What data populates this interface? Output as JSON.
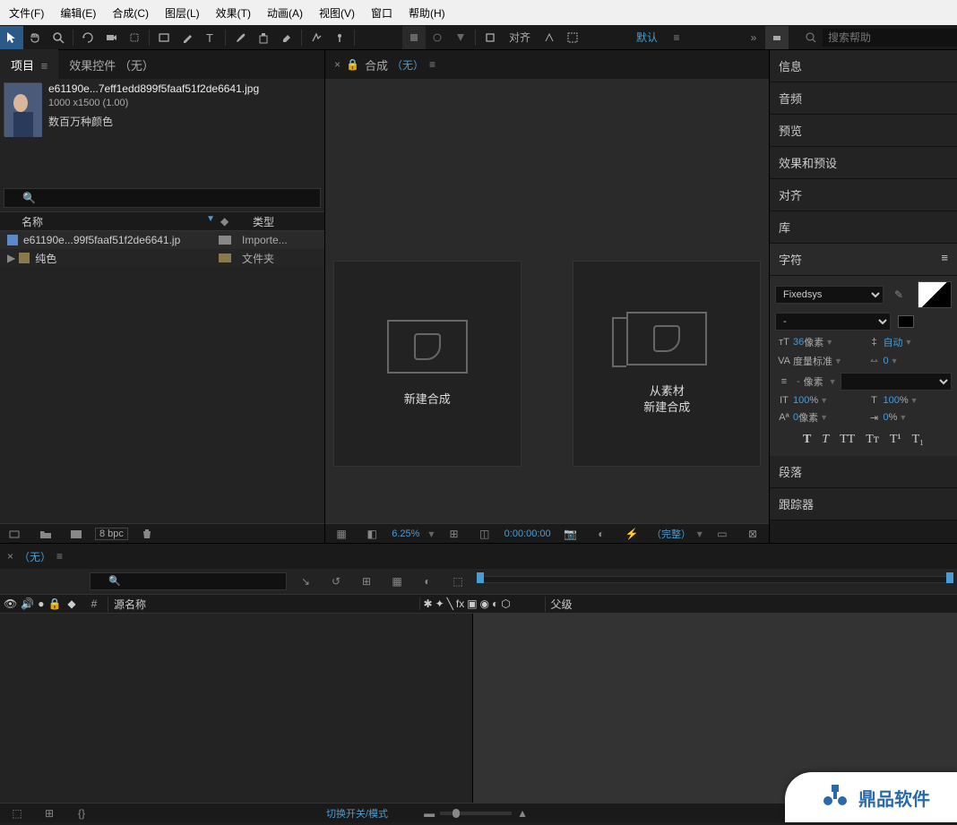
{
  "menubar": [
    "文件(F)",
    "编辑(E)",
    "合成(C)",
    "图层(L)",
    "效果(T)",
    "动画(A)",
    "视图(V)",
    "窗口",
    "帮助(H)"
  ],
  "toolbar": {
    "align_label": "对齐",
    "workspace": "默认",
    "search_ph": "搜索帮助"
  },
  "project": {
    "tab_project": "项目",
    "tab_effects": "效果控件 （无）",
    "asset_name": "e61190e...7eff1edd899f5faaf51f2de6641.jpg",
    "asset_dims": "1000 x1500 (1.00)",
    "asset_color": "数百万种颜色",
    "col_name": "名称",
    "col_type": "类型",
    "row1_name": "e61190e...99f5faaf51f2de6641.jp",
    "row1_type": "Importe...",
    "row2_name": "纯色",
    "row2_type": "文件夹",
    "bpc": "8 bpc"
  },
  "comp": {
    "tab_label": "合成",
    "tab_none": "（无）",
    "tile1": "新建合成",
    "tile2_l1": "从素材",
    "tile2_l2": "新建合成",
    "zoom": "6.25%",
    "time": "0:00:00:00",
    "full": "（完整）"
  },
  "right": {
    "info": "信息",
    "audio": "音频",
    "preview": "预览",
    "effects": "效果和预设",
    "align": "对齐",
    "library": "库",
    "character": "字符",
    "font": "Fixedsys",
    "style": "-",
    "size_val": "36",
    "size_unit": "像素",
    "leading": "自动",
    "tracking_label": "度量标准",
    "tracking_val": "0",
    "px_unit": "像素",
    "dash": "-",
    "hscale": "100",
    "vscale": "100",
    "pct": "%",
    "baseline": "0",
    "tsume": "0",
    "paragraph": "段落",
    "tracker": "跟踪器"
  },
  "timeline": {
    "tab_none": "（无）",
    "col_hash": "#",
    "col_source": "源名称",
    "col_parent": "父级",
    "switch_label": "切换开关/模式"
  },
  "watermark": "鼎品软件"
}
